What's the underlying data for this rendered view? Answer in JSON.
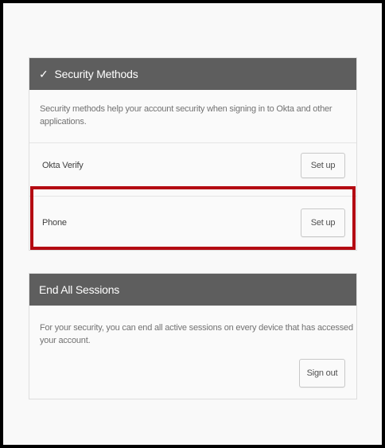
{
  "security_methods": {
    "title": "Security Methods",
    "check_icon": "✓",
    "description": "Security methods help your account security when signing in to Okta and other applications.",
    "methods": [
      {
        "label": "Okta Verify",
        "button_label": "Set up"
      },
      {
        "label": "Phone",
        "button_label": "Set up"
      }
    ]
  },
  "end_sessions": {
    "title": "End All Sessions",
    "description": "For your security, you can end all active sessions on every device that has accessed your account.",
    "button_label": "Sign out"
  },
  "colors": {
    "header_bg": "#5e5e5e",
    "highlight": "#b40a12"
  }
}
